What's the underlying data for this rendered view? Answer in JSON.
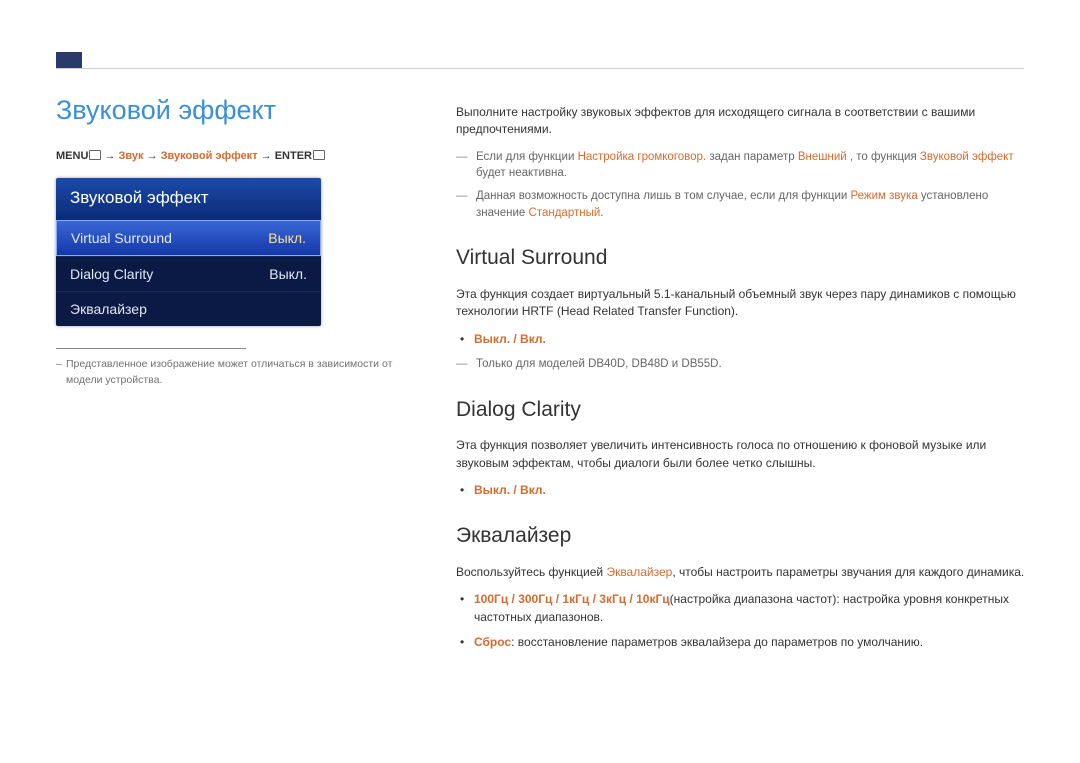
{
  "page_title": "Звуковой эффект",
  "breadcrumb": {
    "menu": "MENU",
    "arrow": " → ",
    "p1": "Звук",
    "p2": "Звуковой эффект",
    "enter": "ENTER"
  },
  "menu": {
    "header": "Звуковой эффект",
    "items": [
      {
        "label": "Virtual Surround",
        "value": "Выкл.",
        "selected": true
      },
      {
        "label": "Dialog Clarity",
        "value": "Выкл.",
        "selected": false
      },
      {
        "label": "Эквалайзер",
        "value": "",
        "selected": false
      }
    ]
  },
  "left_footnote": "Представленное изображение может отличаться в зависимости от модели устройства.",
  "intro": "Выполните настройку звуковых эффектов для исходящего сигнала в соответствии с вашими предпочтениями.",
  "note1": {
    "pre": "Если для функции ",
    "h1": "Настройка громкоговор.",
    "mid1": " задан параметр ",
    "h2": "Внешний",
    "mid2": " , то функция ",
    "h3": "Звуковой эффект",
    "post": " будет неактивна."
  },
  "note2": {
    "pre": "Данная возможность доступна лишь в том случае, если для функции ",
    "h1": "Режим звука",
    "mid": " установлено значение ",
    "h2": "Стандартный",
    "post": "."
  },
  "vs": {
    "title": "Virtual Surround",
    "desc": "Эта функция создает виртуальный 5.1-канальный объемный звук через пару динамиков с помощью технологии HRTF (Head Related Transfer Function).",
    "opts": "Выкл. / Вкл.",
    "note": "Только для моделей DB40D, DB48D и DB55D."
  },
  "dc": {
    "title": "Dialog Clarity",
    "desc": "Эта функция позволяет увеличить интенсивность голоса по отношению к фоновой музыке или звуковым эффектам, чтобы диалоги были более четко слышны.",
    "opts": "Выкл. / Вкл."
  },
  "eq": {
    "title": "Эквалайзер",
    "desc_pre": "Воспользуйтесь функцией ",
    "desc_h": "Эквалайзер",
    "desc_post": ", чтобы настроить параметры звучания для каждого динамика.",
    "b1_h": "100Гц / 300Гц / 1кГц / 3кГц / 10кГц",
    "b1_post": "(настройка диапазона частот): настройка уровня конкретных частотных диапазонов.",
    "b2_h": "Сброс",
    "b2_post": ": восстановление параметров эквалайзера до параметров по умолчанию."
  }
}
